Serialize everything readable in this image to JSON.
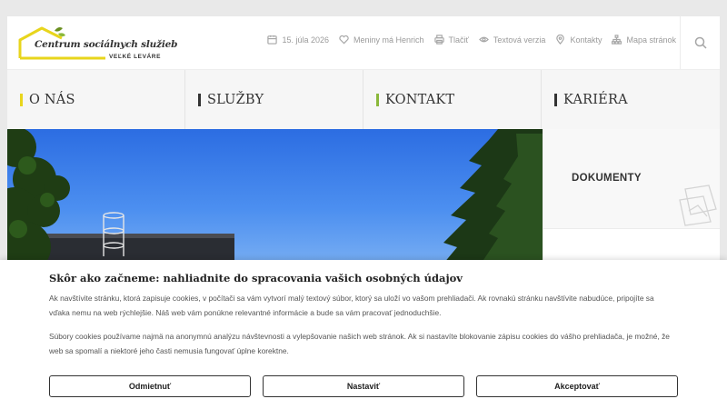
{
  "header": {
    "logo": {
      "line1": "Centrum sociálnych služieb",
      "line2": "VEĽKÉ LEVÁRE",
      "roof_color": "#e8d51c",
      "leaf_color": "#6a8f1f"
    },
    "toplinks": [
      {
        "icon": "calendar-icon",
        "label": "15. júla 2026"
      },
      {
        "icon": "heart-icon",
        "label": "Meniny má Henrich"
      },
      {
        "icon": "printer-icon",
        "label": "Tlačiť"
      },
      {
        "icon": "eye-icon",
        "label": "Textová verzia"
      },
      {
        "icon": "map-pin-icon",
        "label": "Kontakty"
      },
      {
        "icon": "sitemap-icon",
        "label": "Mapa stránok"
      }
    ],
    "search_icon": "search-icon"
  },
  "nav": {
    "items": [
      {
        "label": "O NÁS",
        "bar_color": "#e8d51c"
      },
      {
        "label": "SLUŽBY",
        "bar_color": "#333333"
      },
      {
        "label": "KONTAKT",
        "bar_color": "#8ab83a"
      },
      {
        "label": "KARIÉRA",
        "bar_color": "#333333"
      }
    ]
  },
  "side": {
    "items": [
      {
        "label": "DOKUMENTY",
        "icon": "papers-icon"
      }
    ]
  },
  "cookie": {
    "title": "Skôr ako začneme: nahliadnite do spracovania vašich osobných údajov",
    "paragraph1": "Ak navštívite stránku, ktorá zapisuje cookies, v počítači sa vám vytvorí malý textový súbor, ktorý sa uloží vo vašom prehliadači. Ak rovnakú stránku navštívite nabudúce, pripojíte sa vďaka nemu na web rýchlejšie. Náš web vám ponúkne relevantné informácie a bude sa vám pracovať jednoduchšie.",
    "paragraph2": "Súbory cookies používame najmä na anonymnú analýzu návštevnosti a vylepšovanie našich web stránok. Ak si nastavíte blokovanie zápisu cookies do vášho prehliadača, je možné, že web sa spomalí a niektoré jeho časti nemusia fungovať úplne korektne.",
    "buttons": {
      "reject": "Odmietnuť",
      "settings": "Nastaviť",
      "accept": "Akceptovať"
    }
  }
}
